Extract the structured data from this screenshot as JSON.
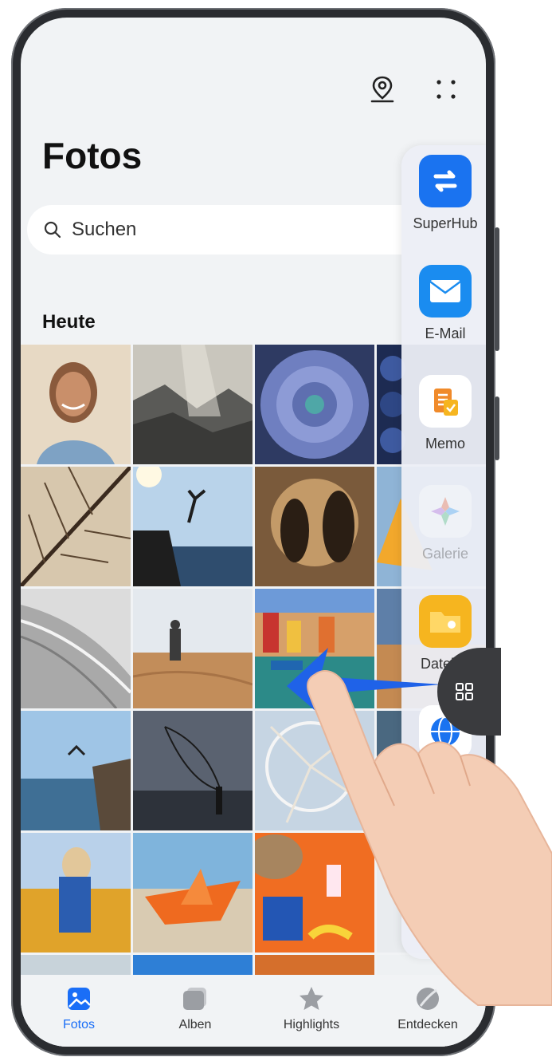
{
  "header": {
    "title": "Fotos",
    "location_icon": "location-pin-icon",
    "more_icon": "more-dots-icon"
  },
  "search": {
    "placeholder": "Suchen"
  },
  "section": {
    "title": "Heute"
  },
  "dock": {
    "items": [
      {
        "label": "SuperHub",
        "icon": "superhub-icon",
        "color": "#1a73f0"
      },
      {
        "label": "E-Mail",
        "icon": "mail-icon",
        "color": "#1a8cf0"
      },
      {
        "label": "Memo",
        "icon": "memo-icon",
        "color": "#ffffff"
      },
      {
        "label": "Galerie",
        "icon": "gallery-icon",
        "color": "#ffffff"
      },
      {
        "label": "Dateien",
        "icon": "files-icon",
        "color": "#f6b51f"
      },
      {
        "label": "",
        "icon": "browser-icon",
        "color": "#1a73f0"
      }
    ]
  },
  "tabs": [
    {
      "label": "Fotos",
      "icon": "photos-icon",
      "active": true
    },
    {
      "label": "Alben",
      "icon": "albums-icon",
      "active": false
    },
    {
      "label": "Highlights",
      "icon": "star-icon",
      "active": false
    },
    {
      "label": "Entdecken",
      "icon": "discover-icon",
      "active": false
    }
  ],
  "colors": {
    "accent": "#1a6ef7",
    "screen_bg": "#f1f3f5",
    "arrow": "#1f62e8"
  }
}
